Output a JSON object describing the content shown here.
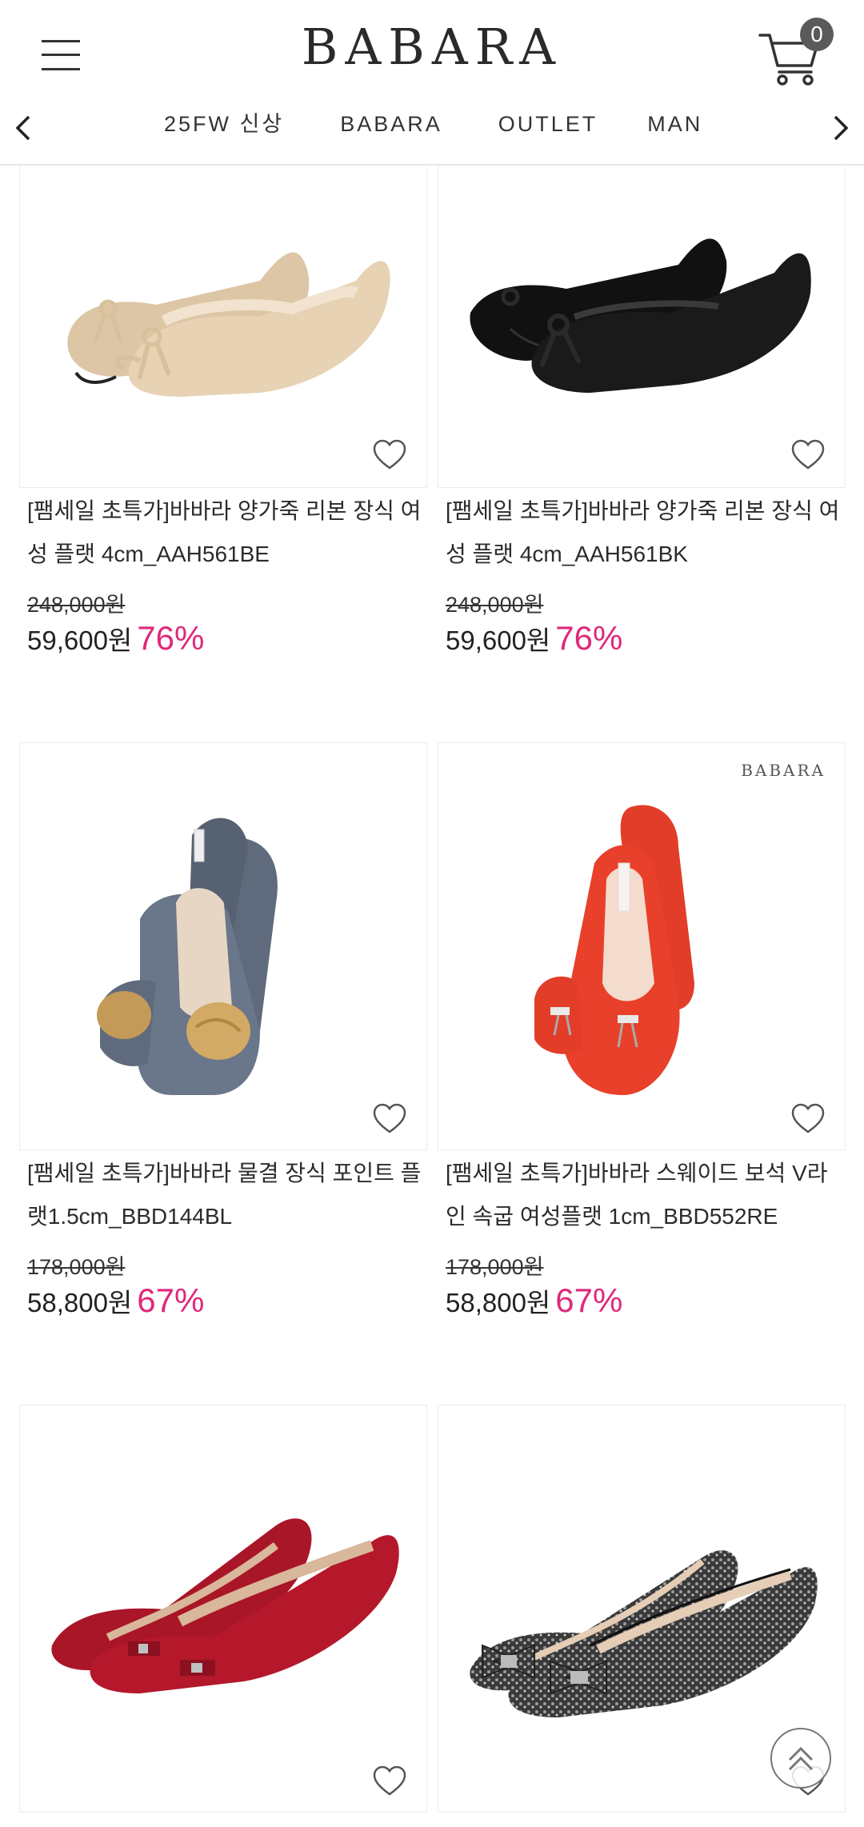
{
  "header": {
    "logo": "BABARA",
    "cart_count": "0"
  },
  "nav": {
    "items": [
      "25FW 신상",
      "BABARA",
      "OUTLET",
      "MAN"
    ]
  },
  "products": [
    {
      "name": "[팸세일 초특가]바바라 양가죽 리본 장식 여성 플랫 4cm_AAH561BE",
      "original_price": "248,000원",
      "sale_price": "59,600원",
      "discount": "76%",
      "color": "#e7d2b4"
    },
    {
      "name": "[팸세일 초특가]바바라 양가죽 리본 장식 여성 플랫 4cm_AAH561BK",
      "original_price": "248,000원",
      "sale_price": "59,600원",
      "discount": "76%",
      "color": "#1a1a1a"
    },
    {
      "name": "[팸세일 초특가]바바라 물결 장식 포인트 플랫1.5cm_BBD144BL",
      "original_price": "178,000원",
      "sale_price": "58,800원",
      "discount": "67%",
      "color": "#5f6b7d"
    },
    {
      "name": "[팸세일 초특가]바바라 스웨이드 보석 V라인 속굽 여성플랫 1cm_BBD552RE",
      "original_price": "178,000원",
      "sale_price": "58,800원",
      "discount": "67%",
      "color": "#e8402a",
      "brand_mark": "BABARA"
    },
    {
      "name": "",
      "color": "#b4182a"
    },
    {
      "name": "",
      "color": "#444444"
    }
  ],
  "colors": {
    "discount": "#e0287a",
    "border": "#ebebeb"
  },
  "icons": {
    "menu": "hamburger-menu-icon",
    "cart": "shopping-cart-icon",
    "heart": "heart-outline-icon",
    "scroll_top": "chevron-up-icon"
  }
}
